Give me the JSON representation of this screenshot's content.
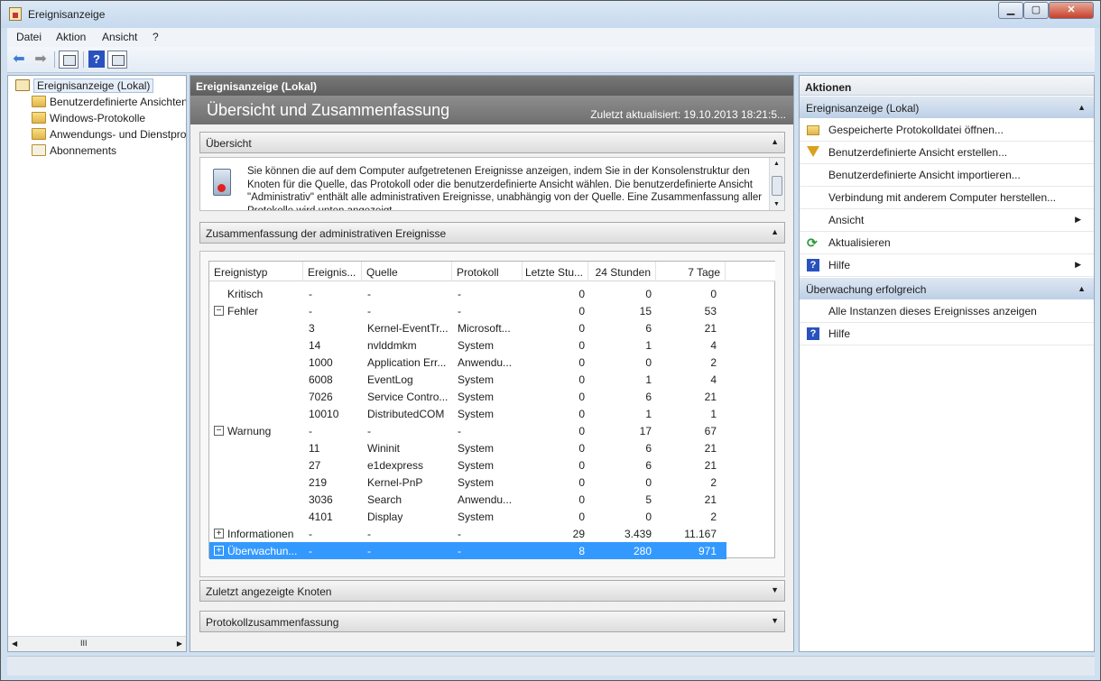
{
  "window": {
    "title": "Ereignisanzeige"
  },
  "menu": [
    "Datei",
    "Aktion",
    "Ansicht",
    "?"
  ],
  "tree": {
    "root": "Ereignisanzeige (Lokal)",
    "items": [
      "Benutzerdefinierte Ansichten",
      "Windows-Protokolle",
      "Anwendungs- und Dienstprotokolle",
      "Abonnements"
    ],
    "hscroll_glyph": "III"
  },
  "center": {
    "header": "Ereignisanzeige (Lokal)",
    "banner_title": "Übersicht und Zusammenfassung",
    "last_updated": "Zuletzt aktualisiert: 19.10.2013 18:21:5...",
    "sections": {
      "overview": "Übersicht",
      "summary": "Zusammenfassung der administrativen Ereignisse",
      "recent_nodes": "Zuletzt angezeigte Knoten",
      "log_summary": "Protokollzusammenfassung"
    },
    "overview_text": "Sie können die auf dem Computer aufgetretenen Ereignisse anzeigen, indem Sie in der Konsolenstruktur den Knoten für die Quelle, das Protokoll oder die benutzerdefinierte Ansicht wählen. Die benutzerdefinierte Ansicht \"Administrativ\" enthält alle administrativen Ereignisse, unabhängig von der Quelle. Eine Zusammenfassung aller Protokolle wird unten angezeigt."
  },
  "table": {
    "columns": [
      "Ereignistyp",
      "Ereignis...",
      "Quelle",
      "Protokoll",
      "Letzte Stu...",
      "24 Stunden",
      "7 Tage"
    ],
    "rows": [
      {
        "type": "Kritisch",
        "id": "-",
        "source": "-",
        "log": "-",
        "hour": "0",
        "day": "0",
        "week": "0",
        "toggle": ""
      },
      {
        "type": "Fehler",
        "id": "-",
        "source": "-",
        "log": "-",
        "hour": "0",
        "day": "15",
        "week": "53",
        "toggle": "−"
      },
      {
        "type": "",
        "id": "3",
        "source": "Kernel-EventTr...",
        "log": "Microsoft...",
        "hour": "0",
        "day": "6",
        "week": "21",
        "toggle": ""
      },
      {
        "type": "",
        "id": "14",
        "source": "nvlddmkm",
        "log": "System",
        "hour": "0",
        "day": "1",
        "week": "4",
        "toggle": ""
      },
      {
        "type": "",
        "id": "1000",
        "source": "Application Err...",
        "log": "Anwendu...",
        "hour": "0",
        "day": "0",
        "week": "2",
        "toggle": ""
      },
      {
        "type": "",
        "id": "6008",
        "source": "EventLog",
        "log": "System",
        "hour": "0",
        "day": "1",
        "week": "4",
        "toggle": ""
      },
      {
        "type": "",
        "id": "7026",
        "source": "Service Contro...",
        "log": "System",
        "hour": "0",
        "day": "6",
        "week": "21",
        "toggle": ""
      },
      {
        "type": "",
        "id": "10010",
        "source": "DistributedCOM",
        "log": "System",
        "hour": "0",
        "day": "1",
        "week": "1",
        "toggle": ""
      },
      {
        "type": "Warnung",
        "id": "-",
        "source": "-",
        "log": "-",
        "hour": "0",
        "day": "17",
        "week": "67",
        "toggle": "−"
      },
      {
        "type": "",
        "id": "11",
        "source": "Wininit",
        "log": "System",
        "hour": "0",
        "day": "6",
        "week": "21",
        "toggle": ""
      },
      {
        "type": "",
        "id": "27",
        "source": "e1dexpress",
        "log": "System",
        "hour": "0",
        "day": "6",
        "week": "21",
        "toggle": ""
      },
      {
        "type": "",
        "id": "219",
        "source": "Kernel-PnP",
        "log": "System",
        "hour": "0",
        "day": "0",
        "week": "2",
        "toggle": ""
      },
      {
        "type": "",
        "id": "3036",
        "source": "Search",
        "log": "Anwendu...",
        "hour": "0",
        "day": "5",
        "week": "21",
        "toggle": ""
      },
      {
        "type": "",
        "id": "4101",
        "source": "Display",
        "log": "System",
        "hour": "0",
        "day": "0",
        "week": "2",
        "toggle": ""
      },
      {
        "type": "Informationen",
        "id": "-",
        "source": "-",
        "log": "-",
        "hour": "29",
        "day": "3.439",
        "week": "11.167",
        "toggle": "+"
      },
      {
        "type": "Überwachun...",
        "id": "-",
        "source": "-",
        "log": "-",
        "hour": "8",
        "day": "280",
        "week": "971",
        "toggle": "+",
        "selected": true
      }
    ]
  },
  "actions": {
    "header": "Aktionen",
    "group1": "Ereignisanzeige (Lokal)",
    "items1": [
      {
        "label": "Gespeicherte Protokolldatei öffnen...",
        "icon": "folder-open-icon"
      },
      {
        "label": "Benutzerdefinierte Ansicht erstellen...",
        "icon": "filter-icon"
      },
      {
        "label": "Benutzerdefinierte Ansicht importieren...",
        "icon": ""
      },
      {
        "label": "Verbindung mit anderem Computer herstellen...",
        "icon": ""
      },
      {
        "label": "Ansicht",
        "icon": "",
        "submenu": true
      },
      {
        "label": "Aktualisieren",
        "icon": "refresh-icon"
      },
      {
        "label": "Hilfe",
        "icon": "help-icon",
        "submenu": true
      }
    ],
    "group2": "Überwachung erfolgreich",
    "items2": [
      {
        "label": "Alle Instanzen dieses Ereignisses anzeigen",
        "icon": ""
      },
      {
        "label": "Hilfe",
        "icon": "help-icon"
      }
    ]
  },
  "colors": {
    "selection": "#3399ff",
    "header_dark": "#6b6b6b",
    "group_header": "#cddcec",
    "help_blue": "#2a52be"
  }
}
